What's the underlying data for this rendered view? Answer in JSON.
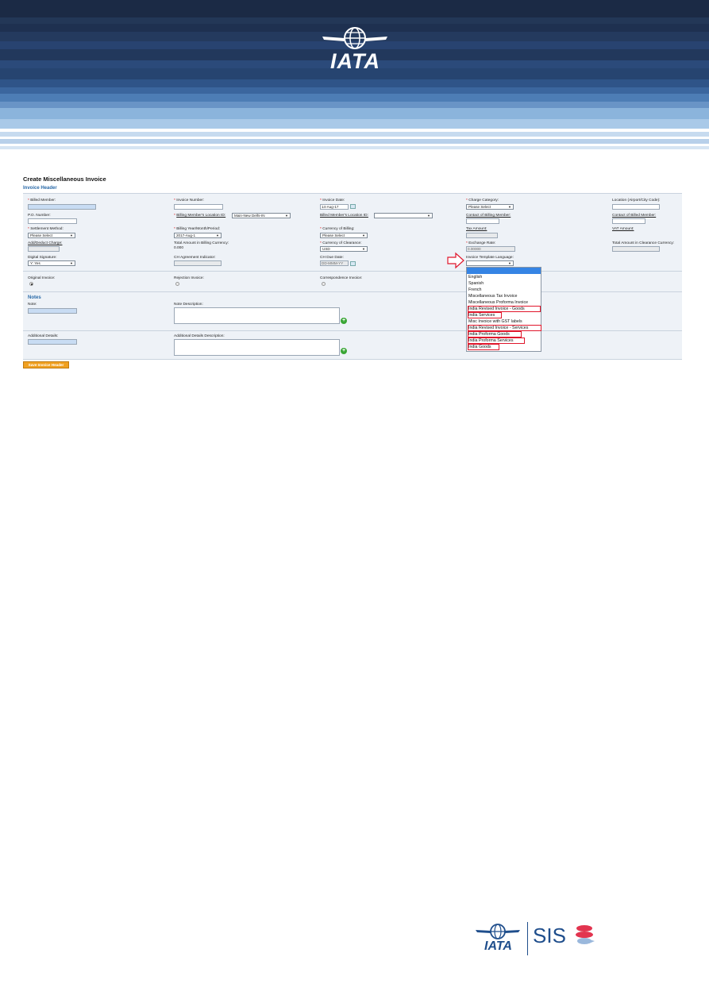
{
  "brand": {
    "header_logo": "IATA",
    "footer_logo": "IATA",
    "footer_product": "SIS"
  },
  "colors": {
    "header_dark": "#1a2a44",
    "header_mid": "#2d4f80",
    "header_light": "#8bb4dc",
    "accent_blue": "#2a6aa8",
    "button_orange": "#f0a020",
    "highlight_red": "#e0162b"
  },
  "page": {
    "title": "Create Miscellaneous Invoice",
    "subtitle": "Invoice Header"
  },
  "fields": {
    "billed_member": "Billed Member:",
    "invoice_number": "Invoice Number:",
    "invoice_date": "Invoice Date:",
    "invoice_date_value": "14-Aug-17",
    "charge_category": "Charge Category:",
    "charge_category_value": "Please Select",
    "location": "Location (Airport/City Code):",
    "po_number": "P.O. Number:",
    "billing_member_location": "Billing Member's Location ID:",
    "billing_member_location_value": "Main-New Delhi-IN",
    "billed_member_location": "Billed Member's Location ID:",
    "contact_billing_member": "Contact of Billing Member:",
    "contact_billed_member": "Contact of Billed Member:",
    "settlement_method": "Settlement Method:",
    "settlement_method_value": "Please Select",
    "billing_year": "Billing Year/Month/Period:",
    "billing_year_value": "2017-Aug-1",
    "currency_billing": "Currency of Billing:",
    "currency_billing_value": "Please Select",
    "tax_amount": "Tax Amount:",
    "vat_amount": "VAT Amount:",
    "add_deduct": "Add/Deduct Charge:",
    "total_billing": "Total Amount in Billing Currency:",
    "total_billing_value": "0.000",
    "currency_clearance": "Currency of Clearance:",
    "currency_clearance_value": "USD",
    "exchange_rate": "Exchange Rate:",
    "exchange_rate_value": "0.00000",
    "total_clearance": "Total Amount in Clearance Currency:",
    "digital_signature": "Digital Signature:",
    "digital_signature_value": "Y: Yes",
    "ch_agreement": "CH Agreement Indicator:",
    "ch_due_date": "CH Due Date:",
    "ch_due_date_placeholder": "DD-MMM-YY",
    "template_language": "Invoice Template Language:",
    "original_invoice": "Original Invoice:",
    "rejection_invoice": "Rejection Invoice:",
    "correspondence_invoice": "Correspondence Invoice:"
  },
  "notes": {
    "heading": "Notes",
    "note": "Note:",
    "note_description": "Note Description:",
    "additional_details": "Additional Details:",
    "additional_details_description": "Additional Details Description:"
  },
  "save_button": "Save Invoice Header",
  "dropdown_options": [
    "English",
    "Spanish",
    "French",
    "Miscellaneous Tax Invoice",
    "Miscellaneous Proforma Invoice",
    "India Revised Invoice - Goods",
    "India Services",
    "Misc Invoice with GST labels",
    "India Revised Invoice - Services",
    "India Proforma Goods",
    "India Proforma Services",
    "India Goods"
  ]
}
